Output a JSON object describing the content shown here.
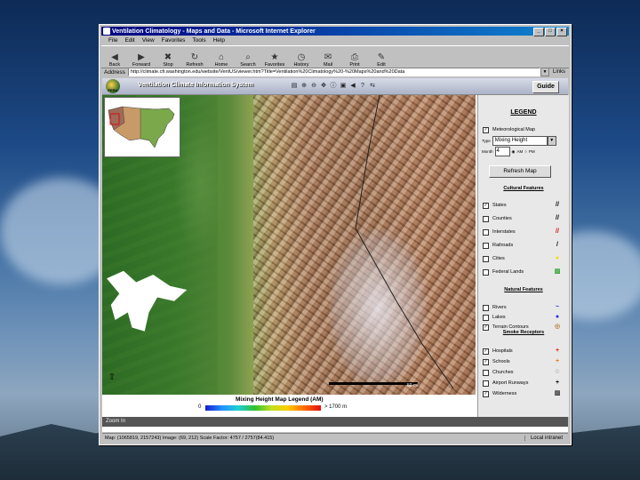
{
  "window": {
    "title": "Ventilation Climatology - Maps and Data - Microsoft Internet Explorer",
    "controls": [
      "_",
      "□",
      "×"
    ]
  },
  "menu": [
    "File",
    "Edit",
    "View",
    "Favorites",
    "Tools",
    "Help"
  ],
  "toolbar": [
    {
      "label": "Back",
      "icon": "back-arrow-icon"
    },
    {
      "label": "Forward",
      "icon": "forward-arrow-icon"
    },
    {
      "label": "Stop",
      "icon": "stop-icon"
    },
    {
      "label": "Refresh",
      "icon": "refresh-icon"
    },
    {
      "label": "Home",
      "icon": "home-icon"
    },
    {
      "label": "Search",
      "icon": "search-icon"
    },
    {
      "label": "Favorites",
      "icon": "favorites-icon"
    },
    {
      "label": "History",
      "icon": "history-icon"
    },
    {
      "label": "Mail",
      "icon": "mail-icon"
    },
    {
      "label": "Print",
      "icon": "print-icon"
    },
    {
      "label": "Edit",
      "icon": "edit-icon"
    }
  ],
  "address": {
    "label": "Address",
    "url": "http://climate.cfr.washington.edu/website/VentUS/viewer.htm?Title=Ventilation%20Climatology%20-%20Maps%20and%20Data",
    "links_label": "Links"
  },
  "app": {
    "logo_text": "FERA",
    "title": "Ventilation Climate Information System",
    "guide_label": "Guide"
  },
  "map": {
    "scale_label": "50 mi",
    "legend_title": "Mixing Height Map Legend (AM)",
    "legend_min": "0",
    "legend_max": "> 1700 m"
  },
  "sidebar": {
    "legend_heading": "LEGEND",
    "met_map_label": "Meteorological Map",
    "type_label": "Type",
    "type_value": "Mixing Height",
    "month_label": "Month",
    "month_value": "4",
    "am_label": "AM",
    "pm_label": "PM",
    "refresh_label": "Refresh Map",
    "cultural_heading": "Cultural Features",
    "cultural": [
      {
        "label": "States",
        "checked": true,
        "symbol": "//",
        "color": "#000000"
      },
      {
        "label": "Counties",
        "checked": false,
        "symbol": "//",
        "color": "#000000"
      },
      {
        "label": "Interstates",
        "checked": false,
        "symbol": "//",
        "color": "#d01010"
      },
      {
        "label": "Railroads",
        "checked": false,
        "symbol": "/",
        "color": "#000000"
      },
      {
        "label": "Cities",
        "checked": false,
        "symbol": "●",
        "color": "#f0e000"
      },
      {
        "label": "Federal Lands",
        "checked": false,
        "symbol": "▨",
        "color": "#30a030"
      }
    ],
    "natural_heading": "Natural Features",
    "natural": [
      {
        "label": "Rivers",
        "checked": false,
        "symbol": "~",
        "color": "#2030d0"
      },
      {
        "label": "Lakes",
        "checked": false,
        "symbol": "●",
        "color": "#2030d0"
      },
      {
        "label": "Terrain Contours",
        "checked": true,
        "symbol": "◎",
        "color": "#b08040"
      }
    ],
    "smoke_heading": "Smoke Receptors",
    "smoke": [
      {
        "label": "Hospitals",
        "checked": true,
        "symbol": "+",
        "color": "#e02010"
      },
      {
        "label": "Schools",
        "checked": true,
        "symbol": "+",
        "color": "#e08010"
      },
      {
        "label": "Churches",
        "checked": false,
        "symbol": "+",
        "color": "#ffffff"
      },
      {
        "label": "Airport Runways",
        "checked": false,
        "symbol": "+",
        "color": "#000000"
      },
      {
        "label": "Wilderness",
        "checked": true,
        "symbol": "▨",
        "color": "#333333"
      }
    ]
  },
  "hint": "Zoom In",
  "status": {
    "text": "Map: (1065819, 2157243)   Image: (69, 212)   Scale Factor: 4757 / 2757(84.415)",
    "zone": "Local intranet"
  }
}
